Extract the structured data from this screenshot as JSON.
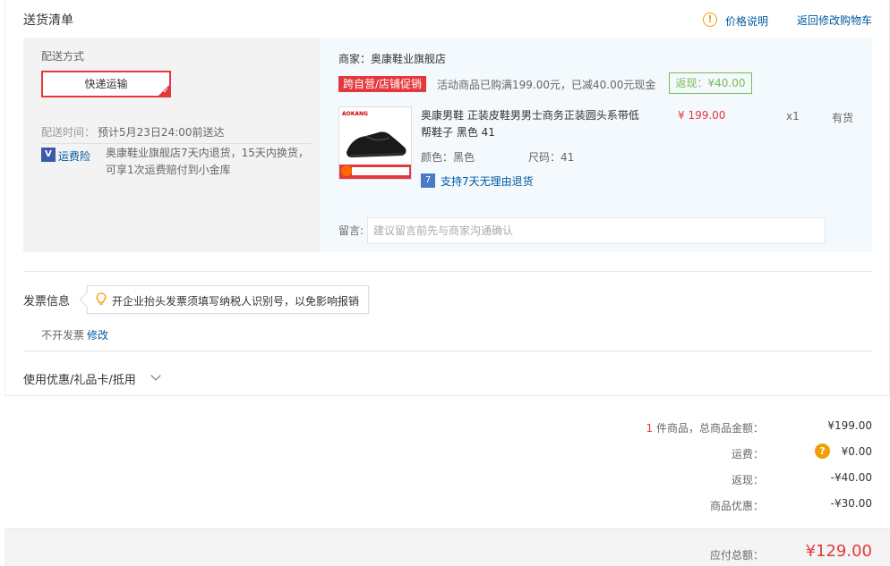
{
  "header": {
    "title": "送货清单",
    "price_info": "价格说明",
    "back_to_cart": "返回修改购物车"
  },
  "shipping": {
    "method_label": "配送方式",
    "method_selected": "快递运输",
    "time_label": "配送时间：",
    "time_value": "预计5月23日24:00前送达",
    "insurance_label": "运费险",
    "insurance_desc": "奥康鞋业旗舰店7天内退货，15天内换货，可享1次运费赔付到小金库"
  },
  "order": {
    "merchant": "商家：奥康鞋业旗舰店",
    "promo_badge": "跨自营/店铺促销",
    "promo_text": "活动商品已购满199.00元，已减40.00元现金",
    "rebate": "返现：¥40.00",
    "product": {
      "brand_mark": "AOKANG",
      "title": "奥康男鞋 正装皮鞋男男士商务正装圆头系带低帮鞋子 黑色 41",
      "color": "颜色：黑色",
      "size": "尺码：41",
      "return_policy": "支持7天无理由退货",
      "price": "¥ 199.00",
      "qty": "x1",
      "stock": "有货"
    },
    "note_label": "留言:",
    "note_placeholder": "建议留言前先与商家沟通确认"
  },
  "invoice": {
    "title": "发票信息",
    "tip": "开企业抬头发票须填写纳税人识别号，以免影响报销",
    "value": "不开发票",
    "edit": "修改"
  },
  "coupon": {
    "label": "使用优惠/礼品卡/抵用"
  },
  "summary": {
    "count": "1",
    "count_label": " 件商品，总商品金额：",
    "goods_total": "¥199.00",
    "freight_label": "运费：",
    "freight": "¥0.00",
    "rebate_label": "返现：",
    "rebate": "-¥40.00",
    "discount_label": "商品优惠：",
    "discount": "-¥30.00",
    "payable_label": "应付总额：",
    "payable": "¥129.00"
  }
}
